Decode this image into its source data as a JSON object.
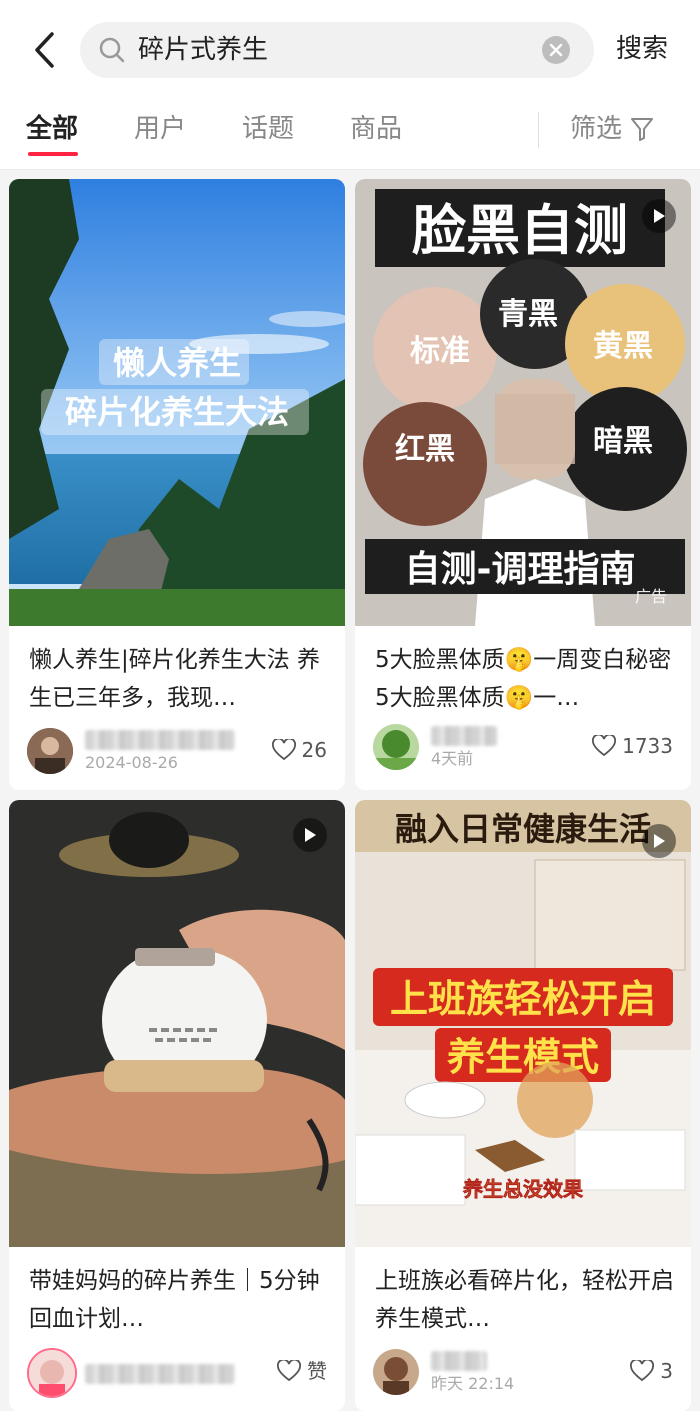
{
  "header": {
    "search_query": "碎片式养生",
    "search_button": "搜索"
  },
  "tabs": [
    {
      "label": "全部"
    },
    {
      "label": "用户"
    },
    {
      "label": "话题"
    },
    {
      "label": "商品"
    }
  ],
  "filter_label": "筛选",
  "colors": {
    "accent": "#ff2442"
  },
  "cards": [
    {
      "cover_title_1": "懒人养生",
      "cover_title_2": "碎片化养生大法",
      "title": "懒人养生|碎片化养生大法 养生已三年多，我现…",
      "author_blurred": "懒",
      "meta": "2024-08-26",
      "likes": "26"
    },
    {
      "cover_title": "脸黑自测",
      "labels": [
        "标准",
        "青黑",
        "黄黑",
        "红黑",
        "暗黑"
      ],
      "cover_footer": "自测-调理指南",
      "ad_tag": "广告",
      "title": "5大脸黑体质🤫一周变白秘密 5大脸黑体质🤫一…",
      "author_blurred": "小",
      "meta": "4天前",
      "likes": "1733"
    },
    {
      "title": "带娃妈妈的碎片养生｜5分钟回血计划…",
      "author_blurred": "带",
      "meta": "",
      "likes": "赞"
    },
    {
      "cover_title": "融入日常健康生活",
      "cover_big_1": "上班族轻松开启",
      "cover_big_2": "养生模式",
      "cover_tag": "养生总没效果",
      "title": "上班族必看碎片化，轻松开启养生模式…",
      "author_blurred": "星",
      "meta": "昨天 22:14",
      "likes": "3"
    }
  ]
}
